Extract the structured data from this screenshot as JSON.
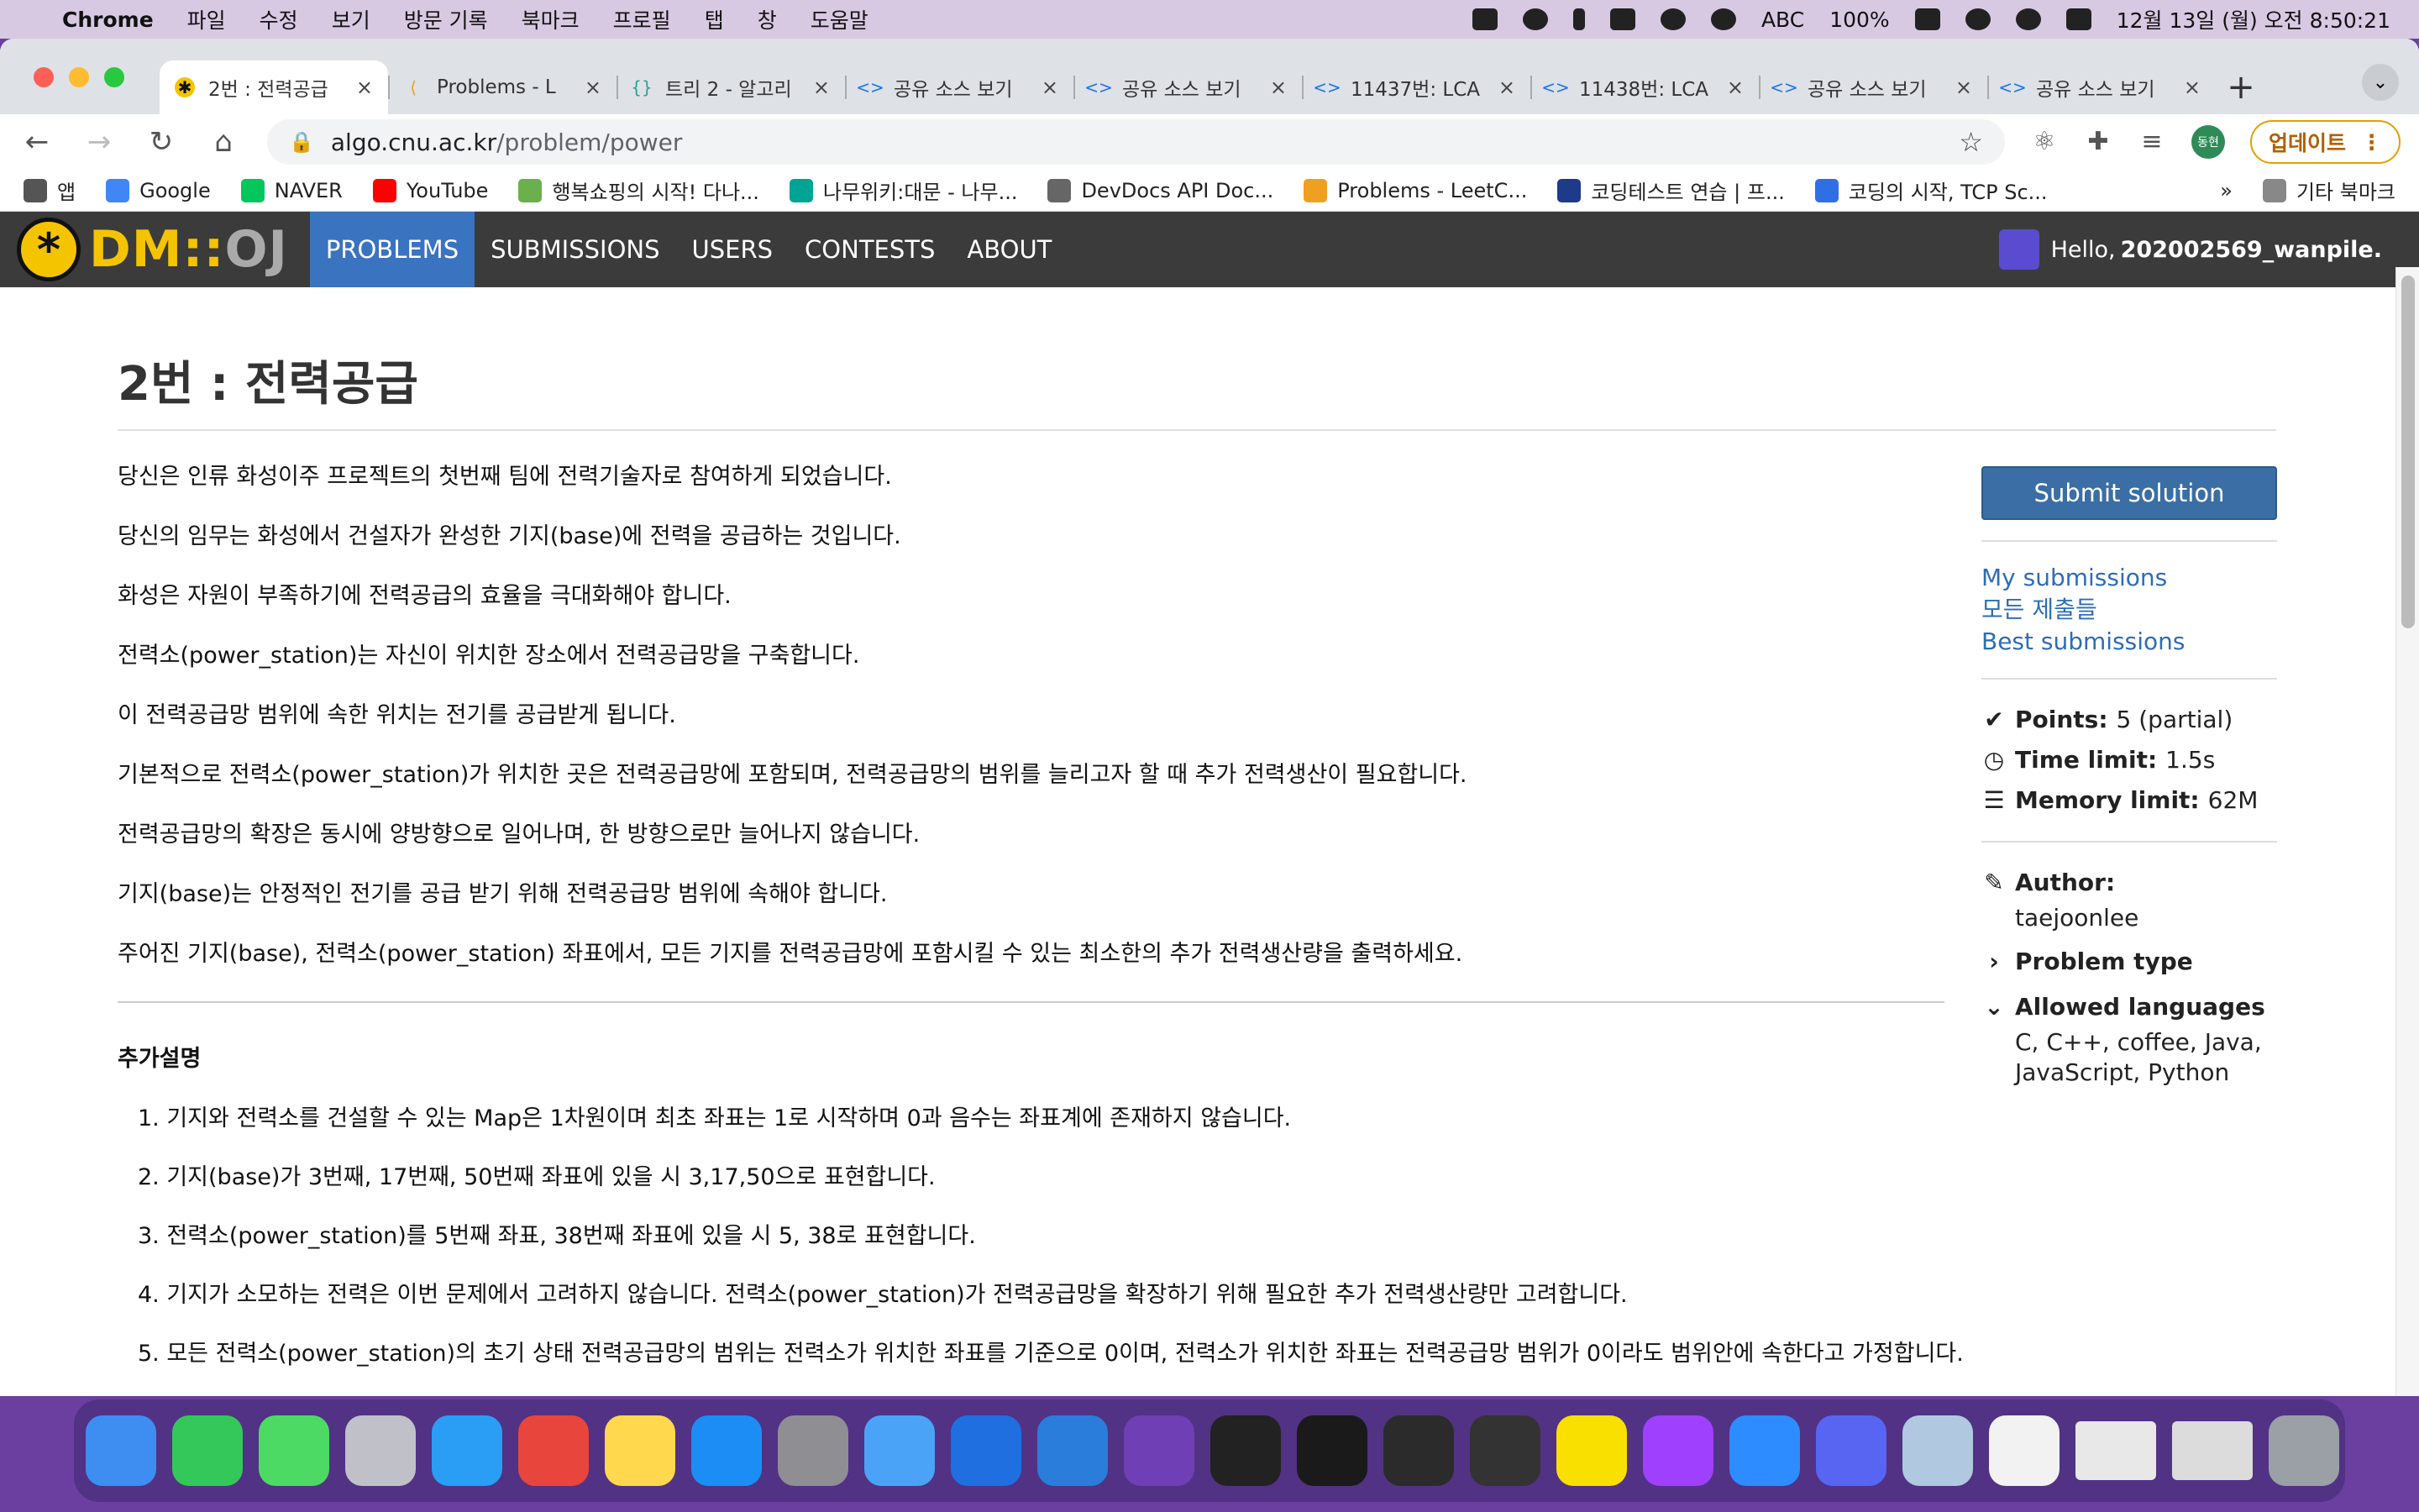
{
  "menubar": {
    "apple": "",
    "app_name": "Chrome",
    "items": [
      "파일",
      "수정",
      "보기",
      "방문 기록",
      "북마크",
      "프로필",
      "탭",
      "창",
      "도움말"
    ],
    "input_source": "ABC",
    "battery": "100%",
    "clock": "12월 13일 (월) 오전 8:50:21"
  },
  "tabs": [
    {
      "title": "2번 : 전력공급",
      "icon": "dmoj-icon"
    },
    {
      "title": "Problems - L",
      "icon": "leetcode-icon"
    },
    {
      "title": "트리 2 - 알고리",
      "icon": "code-braces-icon"
    },
    {
      "title": "공유 소스 보기",
      "icon": "code-icon"
    },
    {
      "title": "공유 소스 보기",
      "icon": "code-icon"
    },
    {
      "title": "11437번: LCA",
      "icon": "code-icon"
    },
    {
      "title": "11438번: LCA",
      "icon": "code-icon"
    },
    {
      "title": "공유 소스 보기",
      "icon": "code-icon"
    },
    {
      "title": "공유 소스 보기",
      "icon": "code-icon"
    }
  ],
  "address": {
    "host": "algo.cnu.ac.kr",
    "path": "/problem/power"
  },
  "profile_badge": "동현",
  "update_label": "업데이트",
  "bookmarks": [
    {
      "label": "앱",
      "color": "#555555"
    },
    {
      "label": "Google",
      "color": "#4285f4"
    },
    {
      "label": "NAVER",
      "color": "#03c75a"
    },
    {
      "label": "YouTube",
      "color": "#ff0000"
    },
    {
      "label": "행복쇼핑의 시작! 다나...",
      "color": "#6ab04c"
    },
    {
      "label": "나무위키:대문 - 나무...",
      "color": "#00a495"
    },
    {
      "label": "DevDocs API Doc...",
      "color": "#666666"
    },
    {
      "label": "Problems - LeetC...",
      "color": "#f0a020"
    },
    {
      "label": "코딩테스트 연습 | 프...",
      "color": "#1e3a8a"
    },
    {
      "label": "코딩의 시작, TCP Sc...",
      "color": "#2f6fe4"
    }
  ],
  "bookmarks_more": "»",
  "other_bookmarks": "기타 북마크",
  "site": {
    "logo_text": "DM::",
    "logo_text2": "OJ",
    "nav": [
      "PROBLEMS",
      "SUBMISSIONS",
      "USERS",
      "CONTESTS",
      "ABOUT"
    ],
    "greeting": "Hello, ",
    "username": "202002569_wanpile."
  },
  "problem": {
    "title": "2번 : 전력공급",
    "paragraphs": [
      "당신은 인류 화성이주 프로젝트의 첫번째 팀에 전력기술자로 참여하게 되었습니다.",
      "당신의 임무는 화성에서 건설자가 완성한 기지(base)에 전력을 공급하는 것입니다.",
      "화성은 자원이 부족하기에 전력공급의 효율을 극대화해야 합니다.",
      "전력소(power_station)는 자신이 위치한 장소에서 전력공급망을 구축합니다.",
      "이 전력공급망 범위에 속한 위치는 전기를 공급받게 됩니다.",
      "기본적으로 전력소(power_station)가 위치한 곳은 전력공급망에 포함되며, 전력공급망의 범위를 늘리고자 할 때 추가 전력생산이 필요합니다.",
      "전력공급망의 확장은 동시에 양방향으로 일어나며, 한 방향으로만 늘어나지 않습니다.",
      "기지(base)는 안정적인 전기를 공급 받기 위해 전력공급망 범위에 속해야 합니다.",
      "주어진 기지(base), 전력소(power_station) 좌표에서, 모든 기지를 전력공급망에 포함시킬 수 있는 최소한의 추가 전력생산량을 출력하세요."
    ],
    "extra_heading": "추가설명",
    "extra_items": [
      "1. 기지와 전력소를 건설할 수 있는 Map은 1차원이며 최초 좌표는 1로 시작하며 0과 음수는 좌표계에 존재하지 않습니다.",
      "2. 기지(base)가 3번째, 17번째, 50번째 좌표에 있을 시 3,17,50으로 표현합니다.",
      "3. 전력소(power_station)를 5번째 좌표, 38번째 좌표에 있을 시 5, 38로 표현합니다.",
      "4. 기지가 소모하는 전력은 이번 문제에서 고려하지 않습니다. 전력소(power_station)가 전력공급망을 확장하기 위해 필요한 추가 전력생산량만 고려합니다.",
      "5. 모든 전력소(power_station)의 초기 상태 전력공급망의 범위는 전력소가 위치한 좌표를 기준으로 0이며, 전력소가 위치한 좌표는 전력공급망 범위가 0이라도 범위안에 속한다고 가정합니다."
    ]
  },
  "sidebar": {
    "submit": "Submit solution",
    "links": [
      "My submissions",
      "모든 제출들",
      "Best submissions"
    ],
    "points_label": "Points:",
    "points_value": "5 (partial)",
    "time_label": "Time limit:",
    "time_value": "1.5s",
    "memory_label": "Memory limit:",
    "memory_value": "62M",
    "author_label": "Author:",
    "author_value": "taejoonlee",
    "problem_type_label": "Problem type",
    "languages_label": "Allowed languages",
    "languages_value": "C, C++, coffee, Java, JavaScript, Python"
  },
  "dock_apps": [
    {
      "name": "finder-icon",
      "color": "#3d8ef0"
    },
    {
      "name": "facetime-icon",
      "color": "#34c759"
    },
    {
      "name": "messages-icon",
      "color": "#4cd964"
    },
    {
      "name": "launchpad-icon",
      "color": "#c0c0c8"
    },
    {
      "name": "safari-icon",
      "color": "#2a9df4"
    },
    {
      "name": "chrome-icon",
      "color": "#e8453c"
    },
    {
      "name": "notes-icon",
      "color": "#ffd84d"
    },
    {
      "name": "app-store-icon",
      "color": "#1c8df5"
    },
    {
      "name": "system-preferences-icon",
      "color": "#8e8e93"
    },
    {
      "name": "mail-icon",
      "color": "#4aa3f7"
    },
    {
      "name": "xcode-icon",
      "color": "#1f6fe0"
    },
    {
      "name": "vscode-icon",
      "color": "#2a7ddb"
    },
    {
      "name": "github-desktop-icon",
      "color": "#6e3fb5"
    },
    {
      "name": "terminal-icon",
      "color": "#222222"
    },
    {
      "name": "iterm-icon",
      "color": "#1a1a1a"
    },
    {
      "name": "activity-monitor-icon",
      "color": "#2b2b2b"
    },
    {
      "name": "console-icon",
      "color": "#333333"
    },
    {
      "name": "kakaotalk-icon",
      "color": "#f9e000"
    },
    {
      "name": "messenger-icon",
      "color": "#a040ff"
    },
    {
      "name": "zoom-icon",
      "color": "#2d8cff"
    },
    {
      "name": "discord-icon",
      "color": "#5865f2"
    },
    {
      "name": "preview-icon",
      "color": "#b0c8e0"
    },
    {
      "name": "textedit-icon",
      "color": "#f2f2f2"
    },
    {
      "name": "window-thumbnail-icon",
      "color": "#e8e8e8"
    },
    {
      "name": "window-thumbnail-icon",
      "color": "#dcdcdc"
    },
    {
      "name": "trash-icon",
      "color": "#9aa0a6"
    }
  ]
}
